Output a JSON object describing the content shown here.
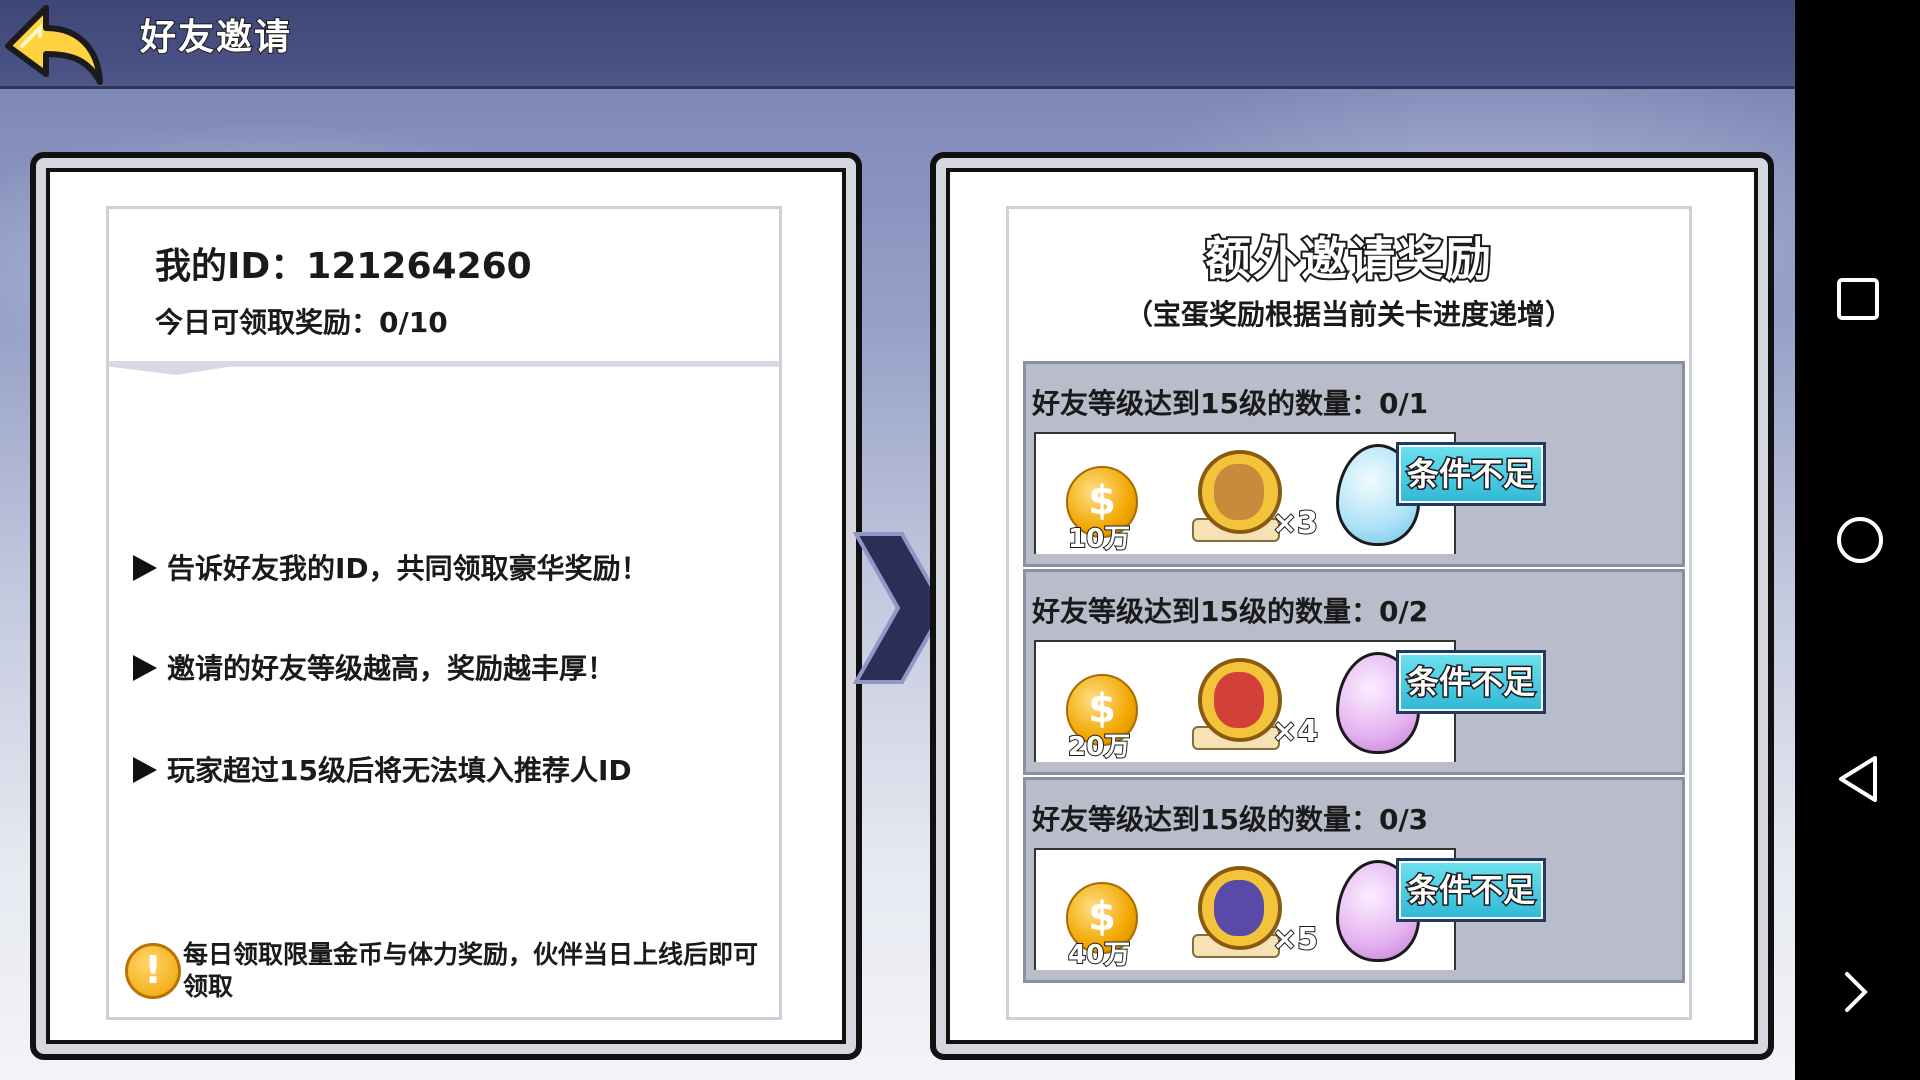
{
  "header": {
    "title": "好友邀请"
  },
  "left_panel": {
    "my_id": "我的ID：121264260",
    "today_claim": "今日可领取奖励：0/10",
    "tips": [
      "告诉好友我的ID，共同领取豪华奖励！",
      "邀请的好友等级越高，奖励越丰厚！",
      "玩家超过15级后将无法填入推荐人ID"
    ],
    "warning": "每日领取限量金币与体力奖励，伙伴当日上线后即可领取"
  },
  "right_panel": {
    "title": "额外邀请奖励",
    "subtitle": "（宝蛋奖励根据当前关卡进度递增）",
    "rewards": [
      {
        "condition": "好友等级达到15级的数量：0/1",
        "coin": "10万",
        "hero_mult": "×3",
        "egg": "ice",
        "button": "条件不足"
      },
      {
        "condition": "好友等级达到15级的数量：0/2",
        "coin": "20万",
        "hero_mult": "×4",
        "egg": "pink",
        "button": "条件不足"
      },
      {
        "condition": "好友等级达到15级的数量：0/3",
        "coin": "40万",
        "hero_mult": "×5",
        "egg": "pink",
        "button": "条件不足"
      }
    ]
  },
  "icons": {
    "back": "back-arrow-icon",
    "coin": "gold-coin-icon",
    "warning": "exclamation-icon",
    "android_recent": "square-icon",
    "android_home": "circle-icon",
    "android_back": "triangle-back-icon",
    "android_more": "chevron-right-icon"
  },
  "colors": {
    "button_cyan": "#2fb8d6",
    "header_bar": "#4d5589",
    "coin_gold": "#f2a700"
  }
}
